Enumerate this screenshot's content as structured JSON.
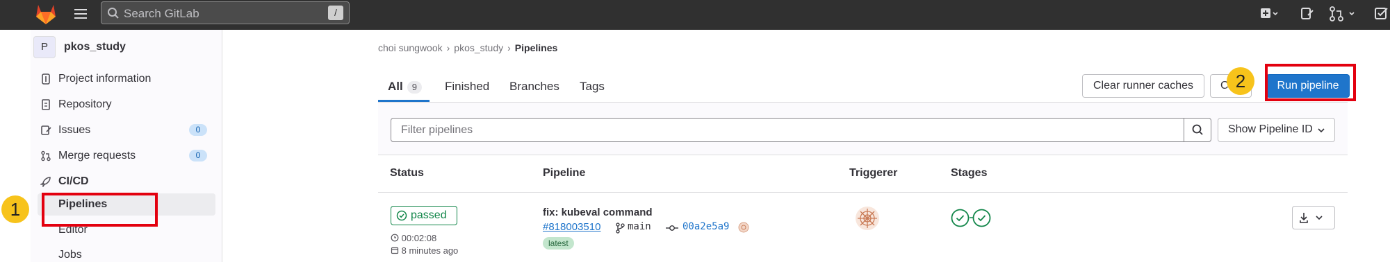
{
  "topbar": {
    "search_placeholder": "Search GitLab",
    "search_shortcut": "/"
  },
  "sidebar": {
    "project_avatar": "P",
    "project_name": "pkos_study",
    "items": [
      {
        "label": "Project information"
      },
      {
        "label": "Repository"
      },
      {
        "label": "Issues",
        "badge": "0"
      },
      {
        "label": "Merge requests",
        "badge": "0"
      },
      {
        "label": "CI/CD"
      }
    ],
    "cicd_sub": [
      {
        "label": "Pipelines"
      },
      {
        "label": "Editor"
      },
      {
        "label": "Jobs"
      }
    ]
  },
  "annotations": {
    "marker1": "1",
    "marker2": "2"
  },
  "breadcrumb": {
    "owner": "choi sungwook",
    "project": "pkos_study",
    "current": "Pipelines"
  },
  "tabs": {
    "all": "All",
    "all_count": "9",
    "finished": "Finished",
    "branches": "Branches",
    "tags": "Tags"
  },
  "actions": {
    "clear_caches": "Clear runner caches",
    "ci_lint_partial": "C",
    "run_pipeline": "Run pipeline"
  },
  "filter": {
    "placeholder": "Filter pipelines",
    "show_id": "Show Pipeline ID"
  },
  "table": {
    "headers": [
      "Status",
      "Pipeline",
      "Triggerer",
      "Stages"
    ],
    "rows": [
      {
        "status": "passed",
        "duration": "00:02:08",
        "finished": "8 minutes ago",
        "commit_title": "fix: kubeval command",
        "pipeline_id": "#818003510",
        "branch": "main",
        "sha": "00a2e5a9",
        "tag": "latest"
      }
    ]
  },
  "colors": {
    "topbar": "#303030",
    "primary": "#1f75cb",
    "success": "#108548",
    "annotation_red": "#e3000f",
    "annotation_marker": "#f7c31b"
  }
}
